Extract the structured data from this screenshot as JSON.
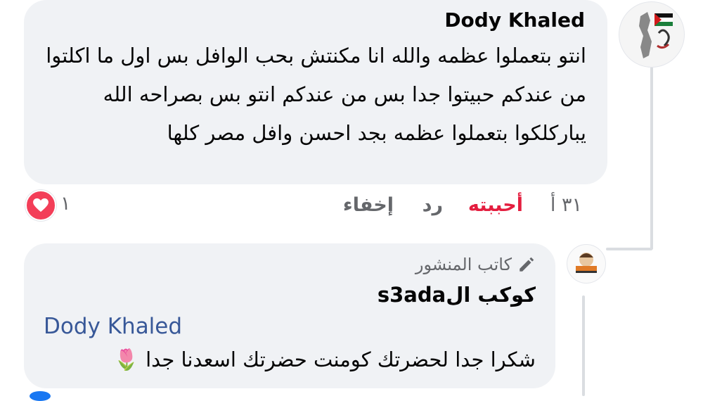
{
  "comment_main": {
    "author": "Dody Khaled",
    "text": "انتو بتعملوا عظمه والله انا مكنتش بحب الوافل بس اول ما اكلتوا من عندكم حبيتوا جدا بس من عندكم انتو بس بصراحه الله يباركلكوا بتعملوا عظمه بجد احسن وافل مصر كلها",
    "time": "٣١ أ",
    "liked_label": "أحببته",
    "reply_label": "رد",
    "hide_label": "إخفاء",
    "reaction_count": "١",
    "liked_color": "#e41e3f",
    "reaction_color": "#f33e58"
  },
  "reply": {
    "author_badge": "كاتب المنشور",
    "author_name": "كوكب الs3ada",
    "mention": "Dody Khaled",
    "text": "شكرا جدا لحضرتك كومنت حضرتك اسعدنا جدا",
    "emoji": "🌷",
    "mention_color": "#385898"
  },
  "icons": [
    "avatar-profile",
    "pencil-icon",
    "heart-icon",
    "tulip-emoji"
  ]
}
